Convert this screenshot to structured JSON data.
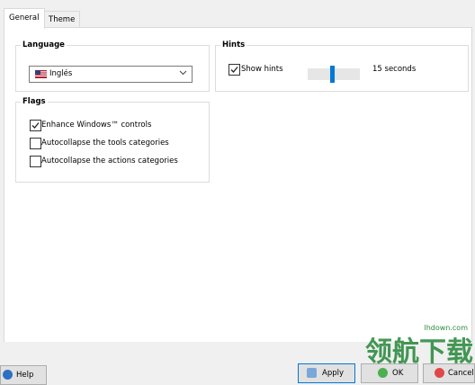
{
  "tabs": [
    {
      "label": "General",
      "active": true
    },
    {
      "label": "Theme",
      "active": false
    }
  ],
  "language": {
    "title": "Language",
    "selected": "Inglés"
  },
  "hints": {
    "title": "Hints",
    "show_label": "Show hints",
    "show_checked": true,
    "duration_text": "15 seconds",
    "slider_fraction": 0.45
  },
  "flags": {
    "title": "Flags",
    "items": [
      {
        "label": "Enhance Windows™ controls",
        "checked": true
      },
      {
        "label": "Autocollapse the tools categories",
        "checked": false
      },
      {
        "label": "Autocollapse the actions categories",
        "checked": false
      }
    ]
  },
  "buttons": {
    "help": "Help",
    "apply": "Apply",
    "ok": "OK",
    "cancel": "Cancel"
  },
  "watermark": {
    "text": "领航下载",
    "url": "lhdown.com"
  },
  "colors": {
    "accent": "#0078d7",
    "watermark": "#2b8a3e"
  },
  "icons": [
    "us-flag-icon",
    "chevron-down-icon",
    "checkmark-icon",
    "help-icon",
    "apply-icon",
    "ok-icon",
    "cancel-icon"
  ]
}
